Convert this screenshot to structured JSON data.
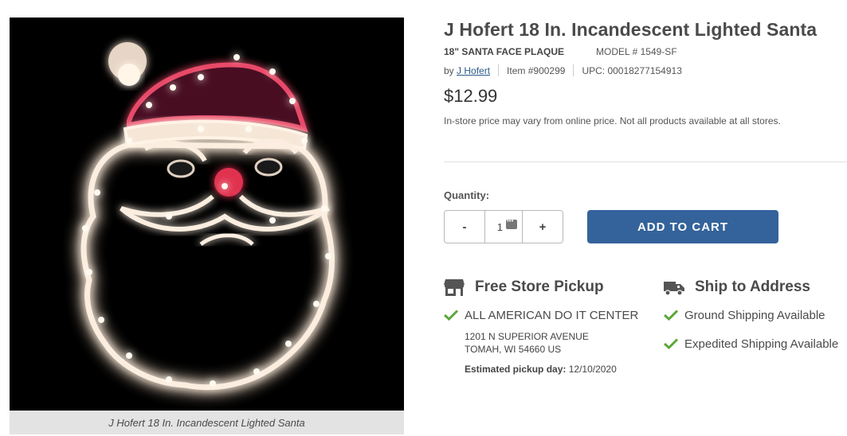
{
  "product": {
    "title": "J Hofert 18 In. Incandescent Lighted Santa",
    "subtitle": "18\" SANTA FACE PLAQUE",
    "model": "MODEL # 1549-SF",
    "by_prefix": "by",
    "brand": "J Hofert",
    "item": "Item #900299",
    "upc": "UPC: 00018277154913",
    "price": "$12.99",
    "price_note": "In-store price may vary from online price. Not all products available at all stores.",
    "image_caption": "J Hofert 18 In. Incandescent Lighted Santa"
  },
  "quantity": {
    "label": "Quantity:",
    "minus": "-",
    "value": "1",
    "plus": "+"
  },
  "cart": {
    "add_label": "ADD TO CART"
  },
  "pickup": {
    "title": "Free Store Pickup",
    "store": "ALL AMERICAN DO IT CENTER",
    "address_line1": "1201 N SUPERIOR AVENUE",
    "address_line2": "TOMAH, WI 54660 US",
    "estimate_label": "Estimated pickup day:",
    "estimate_value": "12/10/2020"
  },
  "ship": {
    "title": "Ship to Address",
    "options": [
      "Ground Shipping Available",
      "Expedited Shipping Available"
    ]
  },
  "colors": {
    "accent": "#34639b",
    "check_green": "#5aa83a",
    "link": "#2b5a8a"
  },
  "icons": {
    "store": "store-icon",
    "truck": "truck-icon",
    "check": "check-icon",
    "keypad": "keypad-icon"
  }
}
